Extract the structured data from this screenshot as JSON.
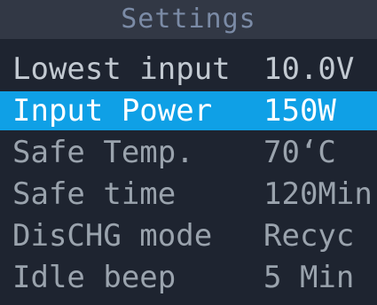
{
  "header": {
    "title": "Settings"
  },
  "menu": {
    "items": [
      {
        "label": "Lowest input",
        "value": "10.0V"
      },
      {
        "label": "Input Power",
        "value": "150W"
      },
      {
        "label": "Safe Temp.",
        "value": "70‘C"
      },
      {
        "label": "Safe time",
        "value": "120Min"
      },
      {
        "label": "DisCHG mode",
        "value": "Recyc"
      },
      {
        "label": "Idle beep",
        "value": "5 Min"
      }
    ],
    "selected_index": 1
  },
  "colors": {
    "background": "#1e2430",
    "title_bar": "#323845",
    "title_text": "#7b8ba6",
    "item_text": "#9aa3ad",
    "highlight": "#0fa0e6",
    "highlight_text": "#ffffff"
  }
}
